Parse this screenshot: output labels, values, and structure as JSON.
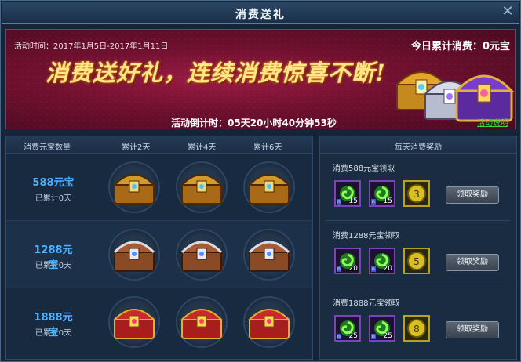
{
  "window": {
    "title": "消费送礼",
    "close_glyph": "✕"
  },
  "banner": {
    "activity_time": "活动时间：2017年1月5日-2017年1月11日",
    "today_total": "今日累计消费：0元宝",
    "slogan": "消费送好礼，连续消费惊喜不断!",
    "countdown": "活动倒计时：05天20小时40分钟53秒",
    "help_link": "活动说明"
  },
  "table": {
    "headers": [
      "消费元宝数量",
      "累计2天",
      "累计4天",
      "累计6天"
    ],
    "rows": [
      {
        "amount": "588元宝",
        "accum": "已累计0天",
        "chest_tier": "gold"
      },
      {
        "amount": "1288元宝",
        "accum": "已累计0天",
        "chest_tier": "silver"
      },
      {
        "amount": "1888元宝",
        "accum": "已累计0天",
        "chest_tier": "red"
      }
    ]
  },
  "rewards": {
    "header": "每天消费奖励",
    "button_label": "领取奖励",
    "tiers": [
      {
        "label": "消费588元宝领取",
        "items": [
          {
            "icon": "green-swirl-icon",
            "count": "15"
          },
          {
            "icon": "green-swirl-icon",
            "count": "15"
          },
          {
            "icon": "gold-coin-icon",
            "count": "3"
          }
        ]
      },
      {
        "label": "消费1288元宝领取",
        "items": [
          {
            "icon": "green-swirl-icon",
            "count": "20"
          },
          {
            "icon": "green-swirl-icon",
            "count": "20"
          },
          {
            "icon": "gold-coin-icon",
            "count": "5"
          }
        ]
      },
      {
        "label": "消费1888元宝领取",
        "items": [
          {
            "icon": "green-swirl-icon",
            "count": "25"
          },
          {
            "icon": "green-swirl-icon",
            "count": "25"
          },
          {
            "icon": "gold-coin-icon",
            "count": "8"
          }
        ]
      }
    ]
  },
  "colors": {
    "accent_blue": "#4fb2ff",
    "link_green": "#34d83e",
    "banner_red": "#70102f"
  }
}
